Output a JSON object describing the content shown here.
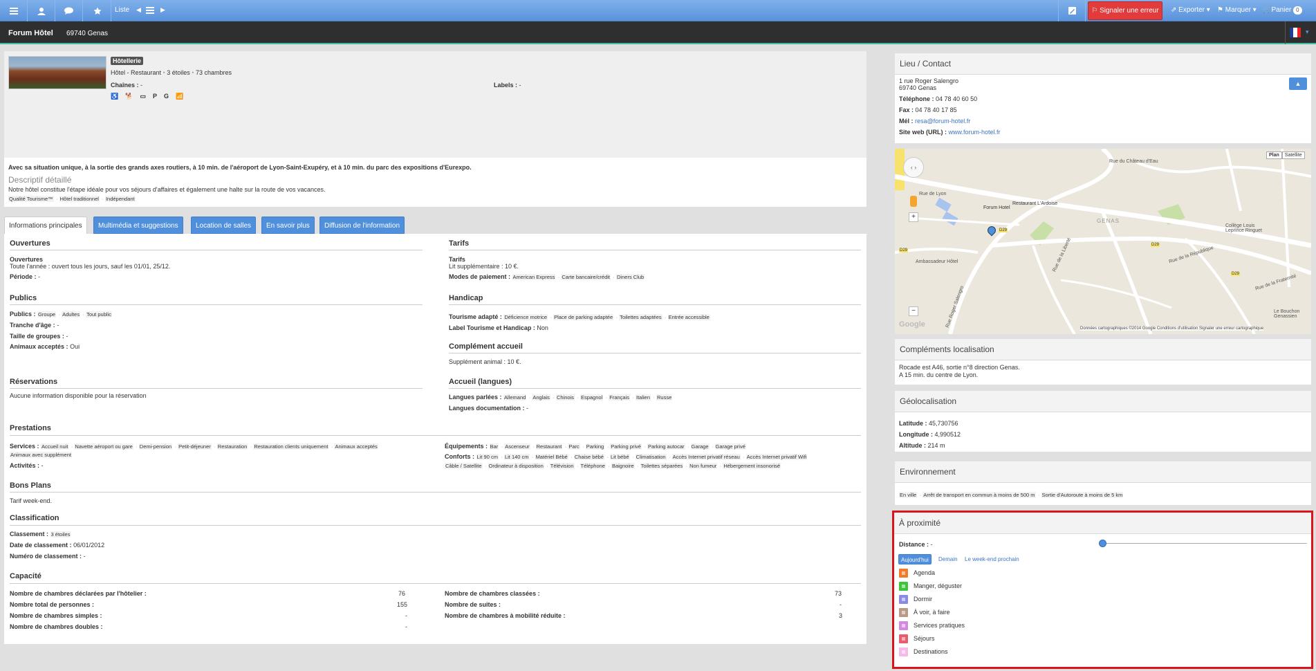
{
  "topbar": {
    "liste_label": "Liste",
    "report_label": "Signaler une erreur",
    "export_label": "Exporter",
    "mark_label": "Marquer",
    "cart_label": "Panier",
    "cart_count": "0"
  },
  "titlebar": {
    "name": "Forum Hôtel",
    "city": "69740 Genas"
  },
  "header": {
    "category": "Hôtellerie",
    "type": "Hôtel - Restaurant",
    "stars": "3 étoiles",
    "rooms": "73 chambres",
    "chains_label": "Chaînes :",
    "chains_value": "-",
    "labels_label": "Labels :",
    "labels_value": "-",
    "icons": [
      "wheelchair-icon",
      "pet-icon",
      "credit-card-icon",
      "parking-icon",
      "restaurant-icon",
      "wifi-icon"
    ],
    "icon_glyphs": [
      "♿",
      "🐕",
      "▭",
      "P",
      "G",
      "📶"
    ],
    "summary": "Avec sa situation unique, à la sortie des grands axes routiers, à 10 min. de l'aéroport de Lyon-Saint-Exupéry, et à 10 min. du parc des expositions d'Eurexpo.",
    "desc_title": "Descriptif détaillé",
    "desc_text": "Notre hôtel constitue l'étape idéale pour vos séjours d'affaires et également une halte sur la route de vos vacances.",
    "desc_tags": [
      "Qualité Tourisme™",
      "Hôtel traditionnel",
      "Indépendant"
    ]
  },
  "tabs": [
    "Informations principales",
    "Multimédia et suggestions",
    "Location de salles",
    "En savoir plus",
    "Diffusion de l'information"
  ],
  "info": {
    "ouvertures_title": "Ouvertures",
    "ouvertures_sub": "Ouvertures",
    "ouvertures_text": "Toute l'année : ouvert tous les jours, sauf les 01/01, 25/12.",
    "periode_label": "Période :",
    "periode_value": "-",
    "publics_title": "Publics",
    "publics_label": "Publics :",
    "publics_tags": [
      "Groupe",
      "Adultes",
      "Tout public"
    ],
    "tranche_label": "Tranche d'âge :",
    "tranche_value": "-",
    "taille_label": "Taille de groupes :",
    "taille_value": "-",
    "animaux_label": "Animaux acceptés :",
    "animaux_value": "Oui",
    "reservations_title": "Réservations",
    "reservations_text": "Aucune information disponible pour la réservation",
    "tarifs_title": "Tarifs",
    "tarifs_sub": "Tarifs",
    "tarifs_text": "Lit supplémentaire : 10 €.",
    "paiement_label": "Modes de paiement :",
    "paiement_tags": [
      "American Express",
      "Carte bancaire/crédit",
      "Diners Club"
    ],
    "handicap_title": "Handicap",
    "tourisme_label": "Tourisme adapté :",
    "tourisme_tags": [
      "Déficience motrice",
      "Place de parking adaptée",
      "Toilettes adaptées",
      "Entrée accessible"
    ],
    "label_th_label": "Label Tourisme et Handicap :",
    "label_th_value": "Non",
    "complement_title": "Complément accueil",
    "complement_text": "Supplément animal : 10 €.",
    "accueil_title": "Accueil (langues)",
    "langues_label": "Langues parlées :",
    "langues_tags": [
      "Allemand",
      "Anglais",
      "Chinois",
      "Espagnol",
      "Français",
      "Italien",
      "Russe"
    ],
    "langues_doc_label": "Langues documentation :",
    "langues_doc_value": "-",
    "prestations_title": "Prestations",
    "services_label": "Services :",
    "services_tags_1": [
      "Accueil nuit",
      "Navette aéroport ou gare",
      "Demi-pension",
      "Petit-déjeuner",
      "Restauration",
      "Restauration clients uniquement",
      "Animaux acceptés"
    ],
    "services_tags_2": [
      "Animaux avec supplément"
    ],
    "activites_label": "Activités :",
    "activites_value": "-",
    "equip_label": "Équipements :",
    "equip_tags": [
      "Bar",
      "Ascenseur",
      "Restaurant",
      "Parc",
      "Parking",
      "Parking privé",
      "Parking autocar",
      "Garage",
      "Garage privé"
    ],
    "conforts_label": "Conforts :",
    "conforts_tags_1": [
      "Lit 90 cm",
      "Lit 140 cm",
      "Matériel Bébé",
      "Chaise bébé",
      "Lit bébé",
      "Climatisation",
      "Accès Internet privatif réseau",
      "Accès Internet privatif Wifi"
    ],
    "conforts_tags_2": [
      "Câble / Satellite",
      "Ordinateur à disposition",
      "Télévision",
      "Téléphone",
      "Baignoire",
      "Toilettes séparées",
      "Non fumeur",
      "Hébergement insonorisé"
    ],
    "bons_title": "Bons Plans",
    "bons_text": "Tarif week-end.",
    "classif_title": "Classification",
    "classement_label": "Classement :",
    "classement_tag": "3 étoiles",
    "date_label": "Date de classement :",
    "date_value": "06/01/2012",
    "numero_label": "Numéro de classement :",
    "numero_value": "-",
    "capacite_title": "Capacité",
    "cap_left": [
      {
        "label": "Nombre de chambres déclarées par l'hôtelier :",
        "value": "76"
      },
      {
        "label": "Nombre total de personnes :",
        "value": "155"
      },
      {
        "label": "Nombre de chambres simples :",
        "value": "-"
      },
      {
        "label": "Nombre de chambres doubles :",
        "value": "-"
      }
    ],
    "cap_right": [
      {
        "label": "Nombre de chambres classées :",
        "value": "73"
      },
      {
        "label": "Nombre de suites :",
        "value": "-"
      },
      {
        "label": "Nombre de chambres à mobilité réduite :",
        "value": "3"
      }
    ]
  },
  "contact": {
    "title": "Lieu / Contact",
    "address1": "1 rue Roger Salengro",
    "address2": "69740 Genas",
    "tel_label": "Téléphone :",
    "tel_value": "04 78 40 60 50",
    "fax_label": "Fax :",
    "fax_value": "04 78 40 17 85",
    "mel_label": "Mél :",
    "mel_value": "resa@forum-hotel.fr",
    "web_label": "Site web (URL) :",
    "web_value": "www.forum-hotel.fr"
  },
  "map": {
    "plan": "Plan",
    "satellite": "Satellite",
    "labels": [
      "Rue du Château d'Eau",
      "Rue de Lyon",
      "Forum Hotel",
      "Restaurant L'Ardoise",
      "GENAS",
      "Collège Louis Leprince Ringuet",
      "Ambassadeur Hôtel",
      "Rue de la République",
      "Rue de la Liberté",
      "Rue de la Fraternité",
      "Rue Roger Salengro",
      "Le Bouchon Genassien",
      "D29",
      "D29",
      "D29",
      "D29"
    ],
    "footer": "Données cartographiques ©2014 Google   Conditions d'utilisation   Signaler une erreur cartographique",
    "google": "Google"
  },
  "complements": {
    "title": "Compléments localisation",
    "line1": "Rocade est A46, sortie n°8 direction Genas.",
    "line2": "A 15 min. du centre de Lyon."
  },
  "geo": {
    "title": "Géolocalisation",
    "lat_label": "Latitude :",
    "lat_value": "45,730756",
    "lon_label": "Longitude :",
    "lon_value": "4,990512",
    "alt_label": "Altitude :",
    "alt_value": "214 m"
  },
  "env": {
    "title": "Environnement",
    "tags": [
      "En ville",
      "Arrêt de transport en commun à moins de 500 m",
      "Sortie d'Autoroute à moins de 5 km"
    ]
  },
  "proximite": {
    "title": "À proximité",
    "distance_label": "Distance :",
    "distance_value": "-",
    "distance_slider": 0,
    "periods": [
      "Aujourd'hui",
      "Demain",
      "Le week-end prochain"
    ],
    "items": [
      {
        "label": "Agenda",
        "color": "#f07b2b"
      },
      {
        "label": "Manger, déguster",
        "color": "#3cc43c"
      },
      {
        "label": "Dormir",
        "color": "#8a8ae6"
      },
      {
        "label": "À voir, à faire",
        "color": "#b89a86"
      },
      {
        "label": "Services pratiques",
        "color": "#d489e0"
      },
      {
        "label": "Séjours",
        "color": "#ea5c6c"
      },
      {
        "label": "Destinations",
        "color": "#f7b8ea"
      }
    ],
    "highlight_color": "#d9141a"
  }
}
